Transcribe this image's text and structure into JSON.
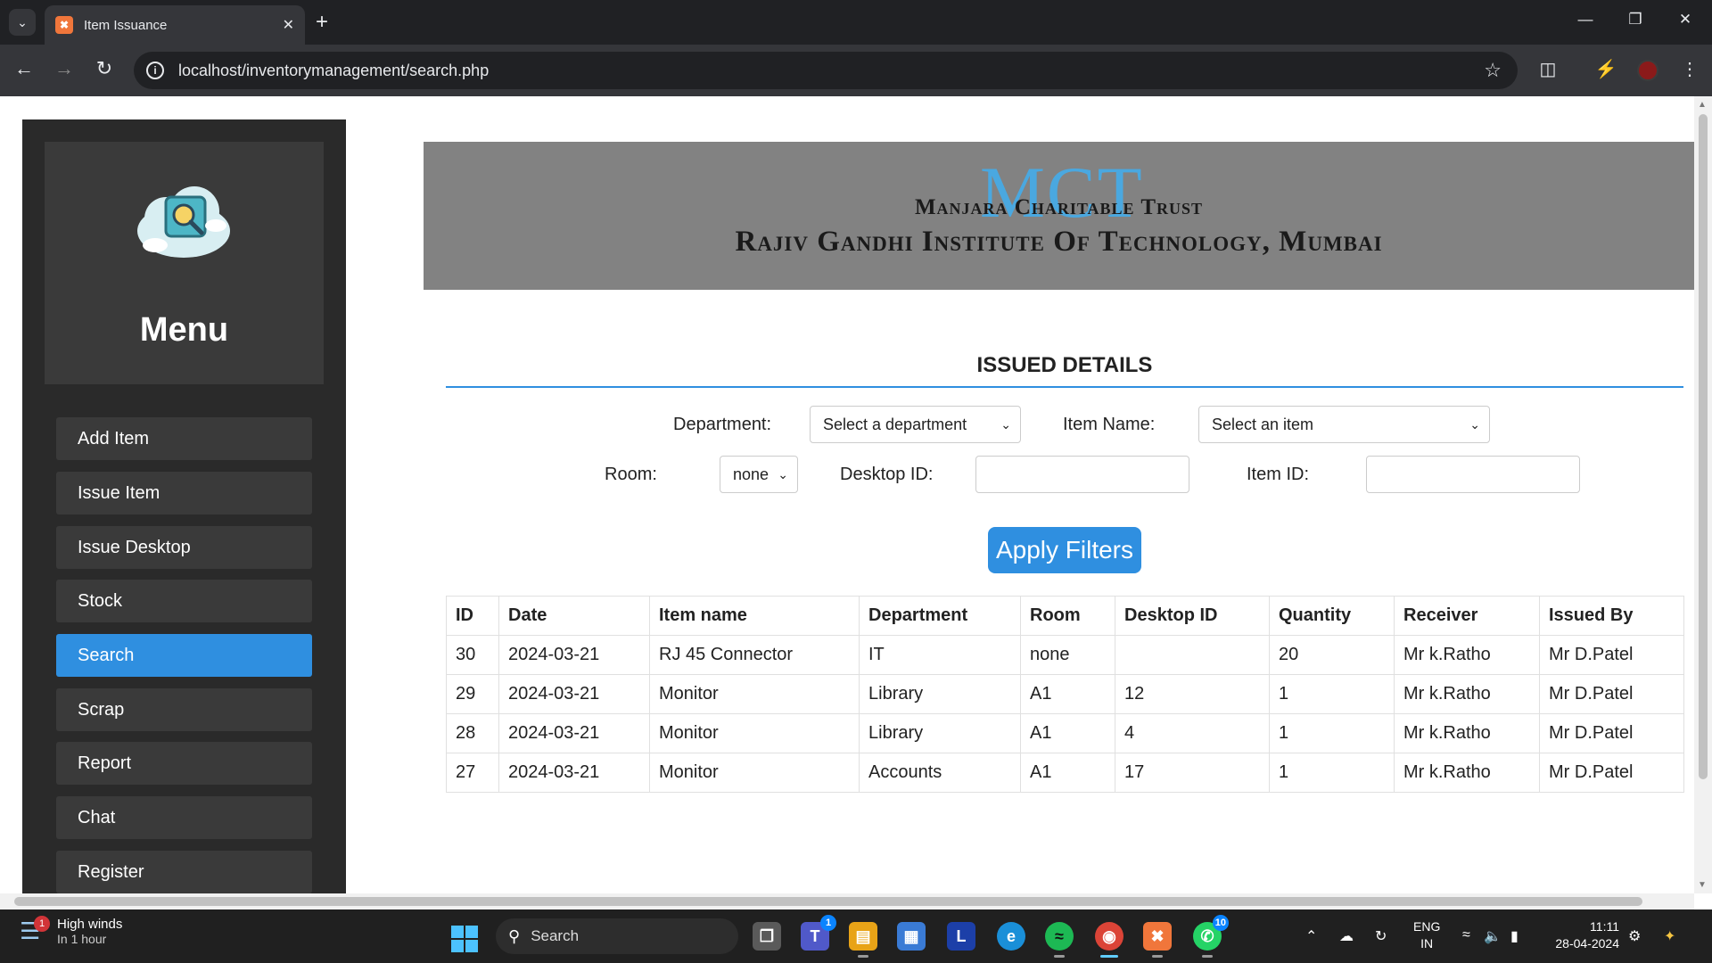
{
  "browser": {
    "tab_title": "Item Issuance",
    "url": "localhost/inventorymanagement/search.php"
  },
  "sidebar": {
    "menu_title": "Menu",
    "items": [
      {
        "label": "Add Item"
      },
      {
        "label": "Issue Item"
      },
      {
        "label": "Issue Desktop"
      },
      {
        "label": "Stock"
      },
      {
        "label": "Search",
        "active": true
      },
      {
        "label": "Scrap"
      },
      {
        "label": "Report"
      },
      {
        "label": "Chat"
      },
      {
        "label": "Register"
      }
    ]
  },
  "banner": {
    "logo_text": "MCT",
    "trust_name": "Manjara Charitable Trust",
    "institute_name": "Rajiv Gandhi Institute Of Technology, Mumbai"
  },
  "main": {
    "section_title": "ISSUED DETAILS",
    "filters": {
      "department_label": "Department:",
      "department_value": "Select a department",
      "item_name_label": "Item Name:",
      "item_name_value": "Select an item",
      "room_label": "Room:",
      "room_value": "none",
      "desktop_id_label": "Desktop ID:",
      "item_id_label": "Item ID:",
      "apply_label": "Apply Filters"
    },
    "table": {
      "headers": [
        "ID",
        "Date",
        "Item name",
        "Department",
        "Room",
        "Desktop ID",
        "Quantity",
        "Receiver",
        "Issued By"
      ],
      "rows": [
        [
          "30",
          "2024-03-21",
          "RJ 45 Connector",
          "IT",
          "none",
          "",
          "20",
          "Mr k.Ratho",
          "Mr D.Patel"
        ],
        [
          "29",
          "2024-03-21",
          "Monitor",
          "Library",
          "A1",
          "12",
          "1",
          "Mr k.Ratho",
          "Mr D.Patel"
        ],
        [
          "28",
          "2024-03-21",
          "Monitor",
          "Library",
          "A1",
          "4",
          "1",
          "Mr k.Ratho",
          "Mr D.Patel"
        ],
        [
          "27",
          "2024-03-21",
          "Monitor",
          "Accounts",
          "A1",
          "17",
          "1",
          "Mr k.Ratho",
          "Mr D.Patel"
        ]
      ]
    }
  },
  "taskbar": {
    "weather_title": "High winds",
    "weather_sub": "In 1 hour",
    "weather_badge": "1",
    "search_label": "Search",
    "teams_badge": "1",
    "whatsapp_badge": "10",
    "lang_top": "ENG",
    "lang_bottom": "IN",
    "time": "11:11",
    "date": "28-04-2024"
  },
  "colors": {
    "accent": "#2f8fe0",
    "sidebar_bg": "#2a2a2a",
    "menu_item_bg": "#3a3a3a",
    "banner_bg": "#828282"
  }
}
